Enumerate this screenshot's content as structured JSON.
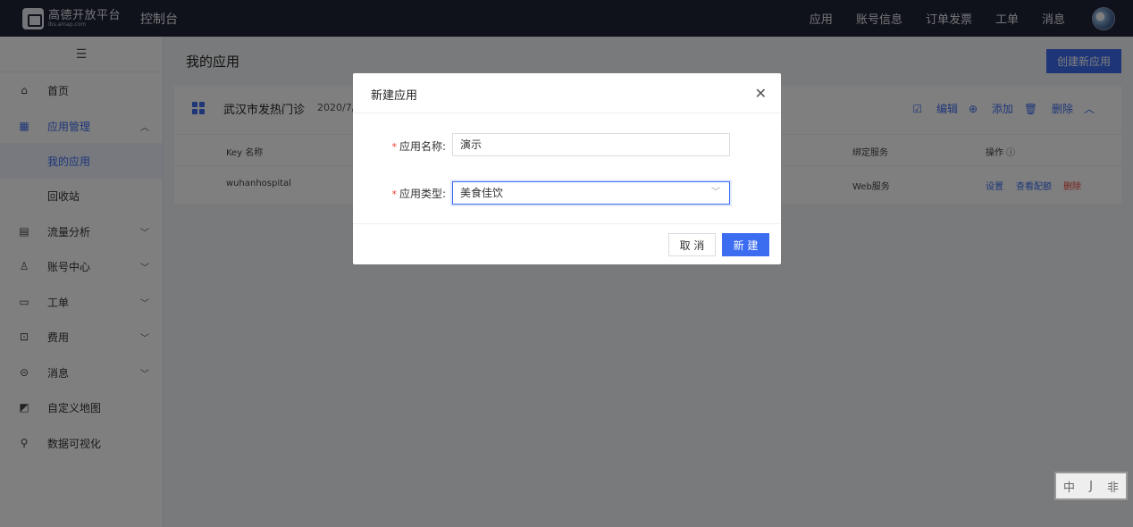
{
  "header": {
    "logo_title": "高德开放平台",
    "logo_sub": "lbs.amap.com",
    "console": "控制台",
    "nav": [
      "应用",
      "账号信息",
      "订单发票",
      "工单",
      "消息"
    ]
  },
  "sidebar": {
    "items": [
      {
        "label": "首页",
        "icon": "home-icon"
      },
      {
        "label": "应用管理",
        "icon": "apps-icon"
      },
      {
        "label": "我的应用"
      },
      {
        "label": "回收站"
      },
      {
        "label": "流量分析",
        "icon": "chart-icon"
      },
      {
        "label": "账号中心",
        "icon": "user-icon"
      },
      {
        "label": "工单",
        "icon": "ticket-icon"
      },
      {
        "label": "费用",
        "icon": "billing-icon"
      },
      {
        "label": "消息",
        "icon": "message-icon"
      },
      {
        "label": "自定义地图",
        "icon": "map-icon"
      },
      {
        "label": "数据可视化",
        "icon": "visual-icon"
      }
    ]
  },
  "main": {
    "title": "我的应用",
    "create_button": "创建新应用",
    "app": {
      "name": "武汉市发热门诊",
      "date": "2020/7/",
      "actions": [
        "编辑",
        "添加",
        "删除"
      ],
      "columns": [
        "Key 名称",
        "绑定服务",
        "操作"
      ],
      "row": {
        "key_name": "wuhanhospital",
        "service": "Web服务",
        "ops": [
          "设置",
          "查看配额",
          "删除"
        ]
      }
    }
  },
  "dialog": {
    "title": "新建应用",
    "name_label": "应用名称:",
    "name_value": "演示",
    "type_label": "应用类型:",
    "type_value": "美食佳饮",
    "cancel": "取 消",
    "confirm": "新 建"
  },
  "stamp": [
    "中",
    "J",
    "非"
  ],
  "colors": {
    "accent": "#3c6df0",
    "topbar": "#1e2336",
    "danger": "#f04134"
  }
}
